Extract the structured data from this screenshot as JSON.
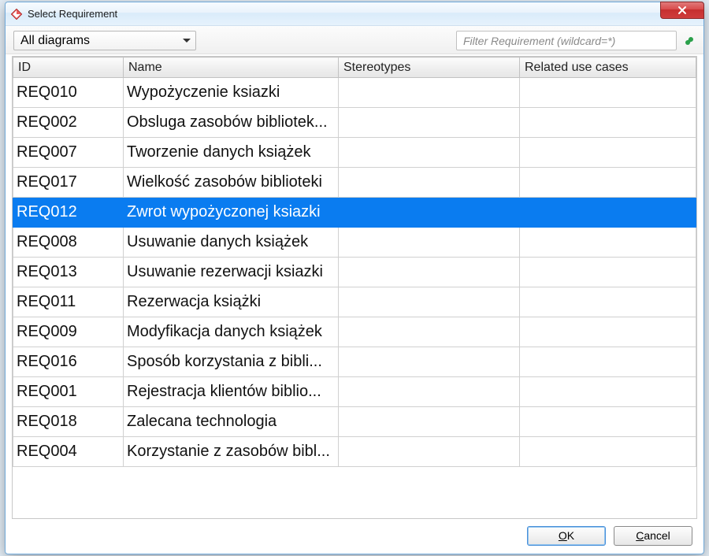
{
  "title": "Select Requirement",
  "toolbar": {
    "scope_selected": "All diagrams",
    "filter_placeholder": "Filter Requirement (wildcard=*)"
  },
  "table": {
    "columns": [
      "ID",
      "Name",
      "Stereotypes",
      "Related use cases"
    ],
    "selected_index": 4,
    "rows": [
      {
        "id": "REQ010",
        "name": "Wypożyczenie ksiazki",
        "stereotypes": "",
        "related": ""
      },
      {
        "id": "REQ002",
        "name": "Obsluga zasobów bibliotek...",
        "stereotypes": "",
        "related": ""
      },
      {
        "id": "REQ007",
        "name": "Tworzenie danych książek",
        "stereotypes": "",
        "related": ""
      },
      {
        "id": "REQ017",
        "name": "Wielkość zasobów biblioteki",
        "stereotypes": "",
        "related": ""
      },
      {
        "id": "REQ012",
        "name": "Zwrot wypożyczonej ksiazki",
        "stereotypes": "",
        "related": ""
      },
      {
        "id": "REQ008",
        "name": "Usuwanie danych książek",
        "stereotypes": "",
        "related": ""
      },
      {
        "id": "REQ013",
        "name": "Usuwanie rezerwacji ksiazki",
        "stereotypes": "",
        "related": ""
      },
      {
        "id": "REQ011",
        "name": "Rezerwacja książki",
        "stereotypes": "",
        "related": ""
      },
      {
        "id": "REQ009",
        "name": "Modyfikacja danych książek",
        "stereotypes": "",
        "related": ""
      },
      {
        "id": "REQ016",
        "name": "Sposób korzystania z bibli...",
        "stereotypes": "",
        "related": ""
      },
      {
        "id": "REQ001",
        "name": "Rejestracja klientów biblio...",
        "stereotypes": "",
        "related": ""
      },
      {
        "id": "REQ018",
        "name": "Zalecana technologia",
        "stereotypes": "",
        "related": ""
      },
      {
        "id": "REQ004",
        "name": "Korzystanie z zasobów bibl...",
        "stereotypes": "",
        "related": ""
      }
    ]
  },
  "buttons": {
    "ok_u": "O",
    "ok_rest": "K",
    "cancel_u": "C",
    "cancel_rest": "ancel"
  }
}
